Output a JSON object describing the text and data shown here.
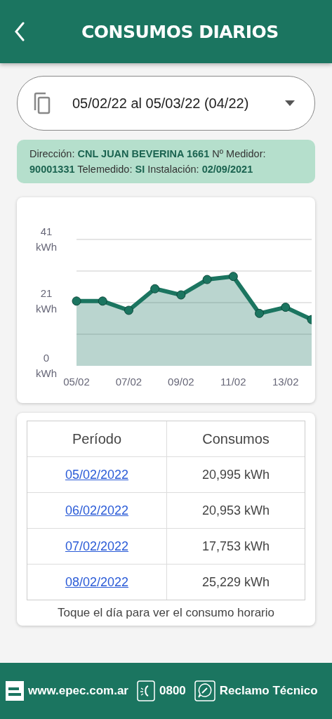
{
  "header": {
    "title": "CONSUMOS DIARIOS"
  },
  "period_select": {
    "value": "05/02/22 al 05/03/22 (04/22)"
  },
  "info": "Dirección: **CNL JUAN BEVERINA 1661** Nº Medidor: **90001331** Telemedido: **SI** Instalación: **02/09/2021**",
  "chart": {
    "chart_data": {
      "type": "area",
      "categories": [
        "05/02",
        null,
        "07/02",
        null,
        "09/02",
        null,
        "11/02",
        null,
        "13/02",
        null
      ],
      "series": [
        {
          "color": "#1b7560",
          "values": [
            21,
            21,
            18,
            25,
            23,
            28,
            29,
            17,
            19,
            15
          ]
        }
      ],
      "ylim": [
        0,
        41
      ],
      "yticks": [
        {
          "value": 0,
          "label": "0 kWh"
        },
        {
          "value": 21,
          "label": "21 kWh"
        },
        {
          "value": 41,
          "label": "41 kWh"
        }
      ]
    }
  },
  "table": {
    "columns": [
      "Período",
      "Consumos"
    ],
    "rows": [
      {
        "date": "05/02/2022",
        "consumo": "20,995 kWh"
      },
      {
        "date": "06/02/2022",
        "consumo": "20,953 kWh"
      },
      {
        "date": "07/02/2022",
        "consumo": "17,753 kWh"
      },
      {
        "date": "08/02/2022",
        "consumo": "25,229 kWh"
      }
    ],
    "hint": "Toque el día para ver el consumo horario"
  },
  "footer": {
    "website": "www.epec.com.ar",
    "phone": "0800",
    "claim": "Reclamo Técnico"
  }
}
